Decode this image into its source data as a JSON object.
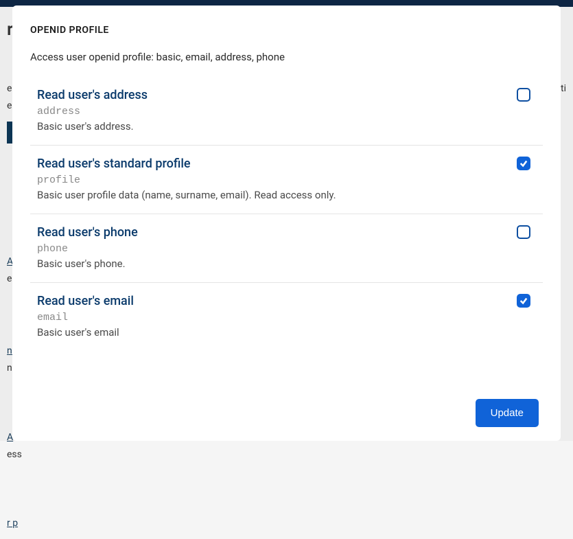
{
  "background": {
    "partial_heading": "re",
    "partial1": "e A",
    "partial2": "cti",
    "partial3": "ed r",
    "partial4": " A",
    "partial5": "ess",
    "partial6": "nlo",
    "partial7": "nlc",
    "partial8": " A",
    "partial9": "ess",
    "partial10": "r p"
  },
  "dialog": {
    "title": "OPENID PROFILE",
    "subtitle": "Access user openid profile: basic, email, address, phone",
    "update_label": "Update"
  },
  "permissions": [
    {
      "title": "Read user's address",
      "code": "address",
      "desc": "Basic user's address.",
      "checked": false
    },
    {
      "title": "Read user's standard profile",
      "code": "profile",
      "desc": "Basic user profile data (name, surname, email). Read access only.",
      "checked": true
    },
    {
      "title": "Read user's phone",
      "code": "phone",
      "desc": "Basic user's phone.",
      "checked": false
    },
    {
      "title": "Read user's email",
      "code": "email",
      "desc": "Basic user's email",
      "checked": true
    }
  ]
}
